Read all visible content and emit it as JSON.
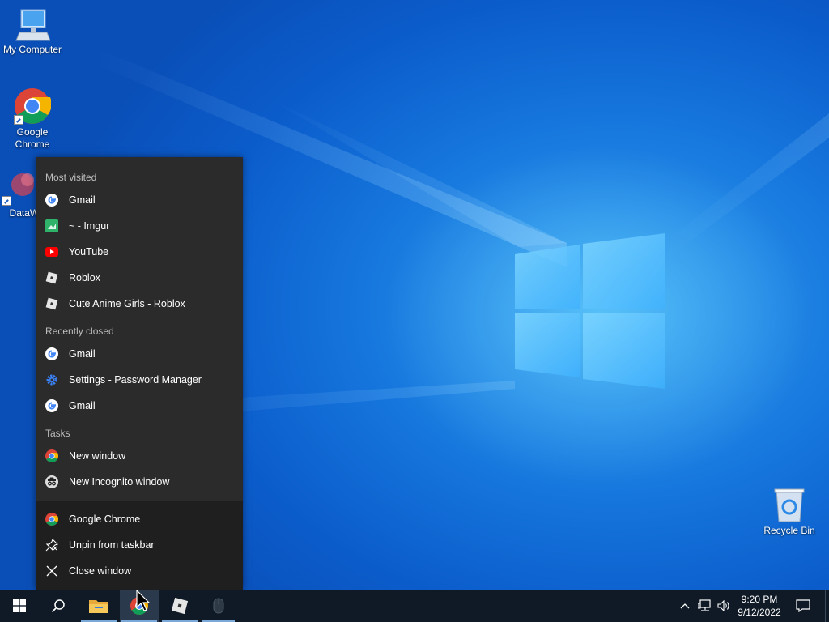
{
  "desktop": {
    "icons": [
      {
        "label": "My Computer"
      },
      {
        "label": "Google Chrome"
      },
      {
        "label": "DataWa"
      },
      {
        "label": "Recycle Bin"
      }
    ]
  },
  "jumplist": {
    "most_visited": {
      "header": "Most visited",
      "items": [
        {
          "label": "Gmail",
          "icon": "google-icon"
        },
        {
          "label": "~ - Imgur",
          "icon": "imgur-icon"
        },
        {
          "label": "YouTube",
          "icon": "youtube-icon"
        },
        {
          "label": "Roblox",
          "icon": "roblox-icon"
        },
        {
          "label": "Cute Anime Girls - Roblox",
          "icon": "roblox-icon"
        }
      ]
    },
    "recently_closed": {
      "header": "Recently closed",
      "items": [
        {
          "label": "Gmail",
          "icon": "google-icon"
        },
        {
          "label": "Settings - Password Manager",
          "icon": "gear-icon"
        },
        {
          "label": "Gmail",
          "icon": "google-icon"
        }
      ]
    },
    "tasks": {
      "header": "Tasks",
      "items": [
        {
          "label": "New window",
          "icon": "chrome-icon"
        },
        {
          "label": "New Incognito window",
          "icon": "incognito-icon"
        }
      ]
    },
    "app_actions": [
      {
        "label": "Google Chrome",
        "icon": "chrome-icon"
      },
      {
        "label": "Unpin from taskbar",
        "icon": "unpin-icon"
      },
      {
        "label": "Close window",
        "icon": "close-icon"
      }
    ]
  },
  "taskbar": {
    "clock": {
      "time": "9:20 PM",
      "date": "9/12/2022"
    },
    "apps": [
      "start-icon",
      "search-icon",
      "file-explorer-icon",
      "chrome-icon",
      "roblox-icon",
      "mouse-app-icon"
    ],
    "tray": [
      "chevron-up-icon",
      "network-icon",
      "volume-icon",
      "notification-icon"
    ]
  },
  "colors": {
    "menu_bg": "#2b2b2b",
    "menu_footer_bg": "#1f1f1f",
    "taskbar_bg": "#0f1a26",
    "desktop_blue": "#1676dd"
  }
}
